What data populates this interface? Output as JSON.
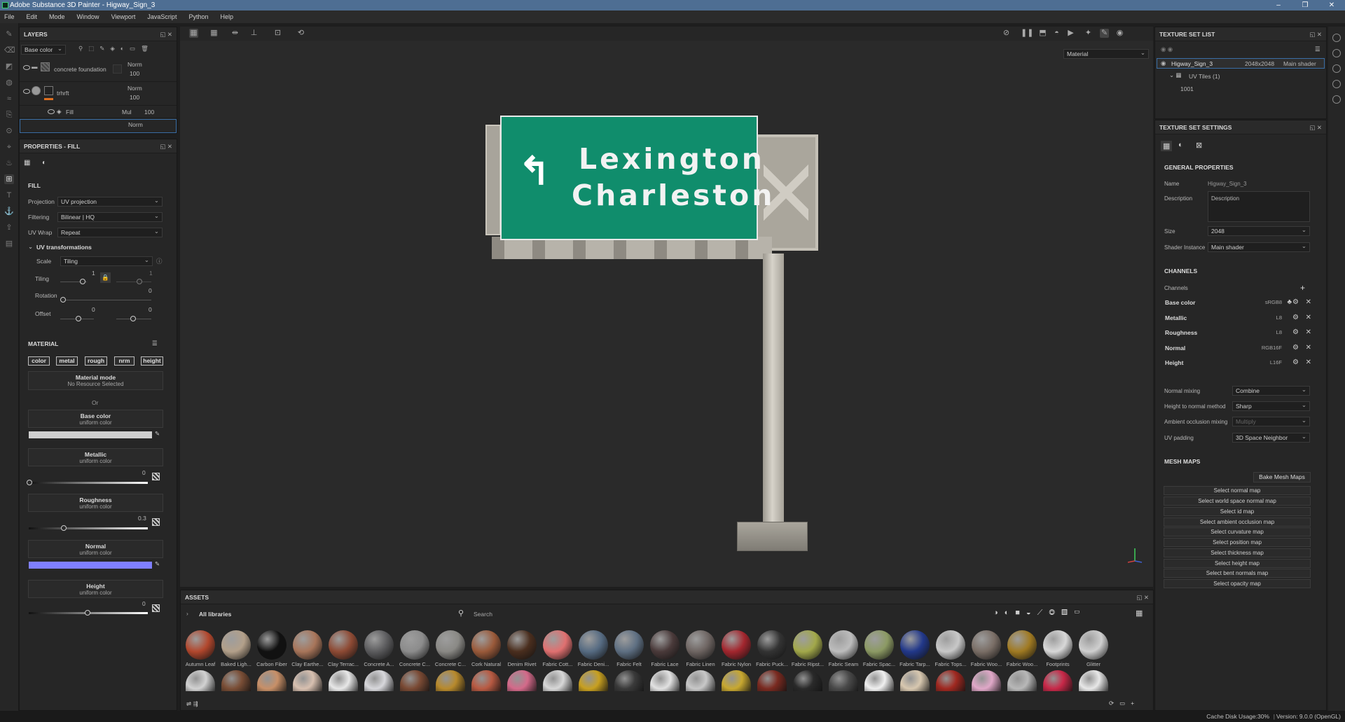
{
  "window": {
    "title": "Adobe Substance 3D Painter - Higway_Sign_3",
    "controls": [
      "–",
      "❐",
      "✕"
    ]
  },
  "menu": [
    "File",
    "Edit",
    "Mode",
    "Window",
    "Viewport",
    "JavaScript",
    "Python",
    "Help"
  ],
  "layers": {
    "title": "LAYERS",
    "channel_select": "Base color",
    "rows": [
      {
        "name": "concrete foundation",
        "blend": "Norm",
        "opacity": "100"
      },
      {
        "name": "trhrft",
        "blend": "Norm",
        "opacity": "100"
      },
      {
        "name": "Fill",
        "blend": "Mul",
        "opacity": "100"
      },
      {
        "name": "",
        "blend": "Norm",
        "opacity": ""
      }
    ]
  },
  "properties": {
    "title": "PROPERTIES - FILL",
    "fill_header": "FILL",
    "projection_label": "Projection",
    "projection": "UV projection",
    "filtering_label": "Filtering",
    "filtering": "Bilinear | HQ",
    "uvwrap_label": "UV Wrap",
    "uvwrap": "Repeat",
    "uvt_header": "UV transformations",
    "scale_label": "Scale",
    "scale": "Tiling",
    "tiling_label": "Tiling",
    "tiling_a": "1",
    "tiling_b": "1",
    "rotation_label": "Rotation",
    "rotation": "0",
    "offset_label": "Offset",
    "offset_a": "0",
    "offset_b": "0",
    "material_header": "MATERIAL",
    "mat_buttons": [
      "color",
      "metal",
      "rough",
      "nrm",
      "height"
    ],
    "material_mode": "Material mode",
    "material_mode_sub": "No Resource Selected",
    "or": "Or",
    "base_color": "Base color",
    "base_color_sub": "uniform color",
    "metallic": "Metallic",
    "metallic_sub": "uniform color",
    "metallic_val": "0",
    "roughness": "Roughness",
    "roughness_sub": "uniform color",
    "roughness_val": "0.3",
    "normal": "Normal",
    "normal_sub": "uniform color",
    "height": "Height",
    "height_sub": "uniform color",
    "height_val": "0",
    "colors": {
      "base": "#cfcfcf",
      "normal": "#7f7fff"
    }
  },
  "viewport": {
    "mode_select": "Material",
    "sign_line1": "Lexington",
    "sign_line2": "Charleston",
    "sign_color": "#108d6c"
  },
  "texture_set_list": {
    "title": "TEXTURE SET LIST",
    "set_name": "Higway_Sign_3",
    "resolution": "2048x2048",
    "shader": "Main shader",
    "uv_tiles": "UV Tiles (1)",
    "tile": "1001"
  },
  "texture_set_settings": {
    "title": "TEXTURE SET SETTINGS",
    "general": "GENERAL PROPERTIES",
    "name_label": "Name",
    "name": "Higway_Sign_3",
    "desc_label": "Description",
    "desc": "Description",
    "size_label": "Size",
    "size": "2048",
    "shader_label": "Shader Instance",
    "shader": "Main shader",
    "channels_header": "CHANNELS",
    "channels_label": "Channels",
    "channels": [
      {
        "name": "Base color",
        "format": "sRGB8"
      },
      {
        "name": "Metallic",
        "format": "L8"
      },
      {
        "name": "Roughness",
        "format": "L8"
      },
      {
        "name": "Normal",
        "format": "RGB16F"
      },
      {
        "name": "Height",
        "format": "L16F"
      }
    ],
    "normal_mixing_label": "Normal mixing",
    "normal_mixing": "Combine",
    "h2n_label": "Height to normal method",
    "h2n": "Sharp",
    "ao_label": "Ambient occlusion mixing",
    "ao": "Multiply",
    "uvpad_label": "UV padding",
    "uvpad": "3D Space Neighbor",
    "mesh_maps_header": "MESH MAPS",
    "bake_button": "Bake Mesh Maps",
    "mesh_maps": [
      "Select normal map",
      "Select world space normal map",
      "Select id map",
      "Select ambient occlusion map",
      "Select curvature map",
      "Select position map",
      "Select thickness map",
      "Select height map",
      "Select bent normals map",
      "Select opacity map"
    ]
  },
  "assets": {
    "title": "ASSETS",
    "library": "All libraries",
    "search_placeholder": "Search",
    "row1": [
      {
        "name": "Autumn Leaf",
        "color": "#b2472d"
      },
      {
        "name": "Baked Ligh...",
        "color": "#b3a08a"
      },
      {
        "name": "Carbon Fiber",
        "color": "#111111"
      },
      {
        "name": "Clay Earthe...",
        "color": "#a8755a"
      },
      {
        "name": "Clay Terrac...",
        "color": "#8e4a34"
      },
      {
        "name": "Concrete A...",
        "color": "#5c5c5e"
      },
      {
        "name": "Concrete C...",
        "color": "#8c8c8c"
      },
      {
        "name": "Concrete C...",
        "color": "#8a8985"
      },
      {
        "name": "Cork Natural",
        "color": "#9a5a3a"
      },
      {
        "name": "Denim Rivet",
        "color": "#4a2e1e"
      },
      {
        "name": "Fabric Cott...",
        "color": "#e07070"
      },
      {
        "name": "Fabric Deni...",
        "color": "#566b82"
      },
      {
        "name": "Fabric Felt",
        "color": "#5e6f82"
      },
      {
        "name": "Fabric Lace",
        "color": "#4a3a3a"
      },
      {
        "name": "Fabric Linen",
        "color": "#6e6562"
      },
      {
        "name": "Fabric Nylon",
        "color": "#a3262e"
      },
      {
        "name": "Fabric Puck...",
        "color": "#333333"
      },
      {
        "name": "Fabric Ripst...",
        "color": "#a2a84a"
      },
      {
        "name": "Fabric Seam",
        "color": "#bdbdbd"
      },
      {
        "name": "Fabric Spac...",
        "color": "#8c9a64"
      },
      {
        "name": "Fabric Tarp...",
        "color": "#22388a"
      },
      {
        "name": "Fabric Tops...",
        "color": "#c8c8c8"
      },
      {
        "name": "Fabric Woo...",
        "color": "#7a6e66"
      },
      {
        "name": "Fabric Woo...",
        "color": "#a07a22"
      },
      {
        "name": "Footprints",
        "color": "#d8d8d8"
      },
      {
        "name": "Glitter",
        "color": "#cfcfcf"
      }
    ],
    "row2": [
      "#d2d2d2",
      "#7a4e36",
      "#c89068",
      "#d8c0b0",
      "#e8e8e8",
      "#d8d8dc",
      "#7a4a34",
      "#b88a2c",
      "#b85a42",
      "#d46a8a",
      "#d8d8d8",
      "#c8a020",
      "#3a3a3a",
      "#e2e2e2",
      "#c8c8c8",
      "#c8a830",
      "#7a2a20",
      "#2a2a2a",
      "#4a4a4a",
      "#f0f0f0",
      "#d8c8b0",
      "#a02820",
      "#e0a8c8",
      "#b8b8b8",
      "#c82848",
      "#e8e8e8"
    ]
  },
  "status": {
    "cache": "Cache Disk Usage:",
    "usage": "30%",
    "version": "Version: 9.0.0 (OpenGL)"
  }
}
